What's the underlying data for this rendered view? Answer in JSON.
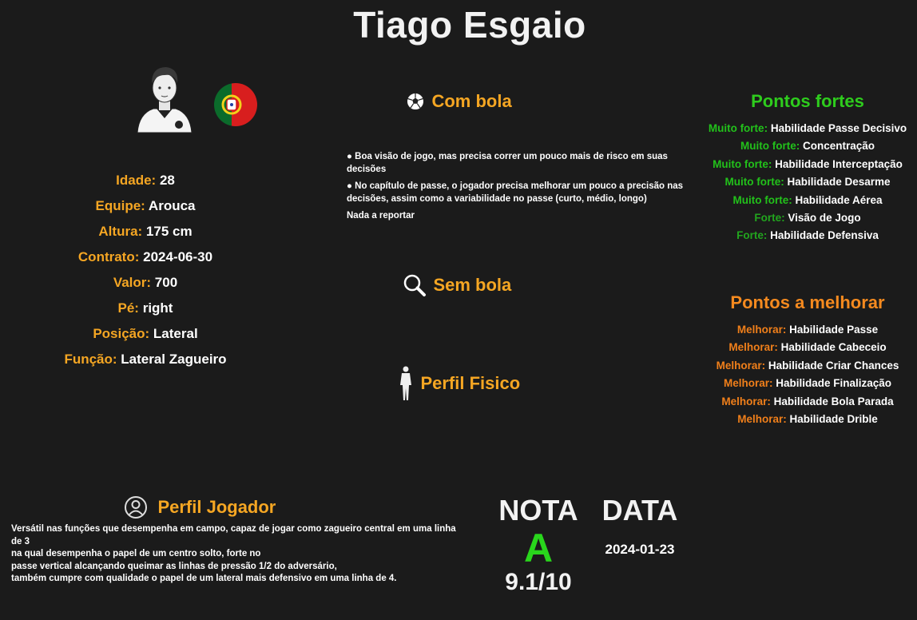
{
  "player": {
    "name": "Tiago Esgaio",
    "details": [
      {
        "label": "Idade:",
        "value": "28"
      },
      {
        "label": "Equipe:",
        "value": "Arouca"
      },
      {
        "label": "Altura:",
        "value": "175 cm"
      },
      {
        "label": "Contrato:",
        "value": "2024-06-30"
      },
      {
        "label": "Valor:",
        "value": "700"
      },
      {
        "label": "Pé:",
        "value": "right"
      },
      {
        "label": "Posição:",
        "value": "Lateral"
      },
      {
        "label": "Função:",
        "value": "Lateral Zagueiro"
      }
    ],
    "avatar_icon": "player-avatar-icon",
    "flag_icon": "portugal-flag-icon"
  },
  "com_bola": {
    "title": "Com bola",
    "icon": "soccer-ball-icon",
    "bullets": [
      "● Boa visão de jogo, mas precisa correr um pouco mais de risco em suas decisões",
      "● No capítulo de passe, o jogador precisa melhorar um pouco a precisão nas decisões, assim como a variabilidade no passe (curto, médio, longo)",
      "Nada a reportar"
    ]
  },
  "sem_bola": {
    "title": "Sem bola",
    "icon": "magnifier-icon"
  },
  "perfil_fisico": {
    "title": "Perfil Fisico",
    "icon": "body-silhouette-icon"
  },
  "pontos_fortes": {
    "title": "Pontos fortes",
    "items": [
      {
        "level": "Muito forte:",
        "skill": "Habilidade Passe Decisivo"
      },
      {
        "level": "Muito forte:",
        "skill": "Concentração"
      },
      {
        "level": "Muito forte:",
        "skill": "Habilidade Interceptação"
      },
      {
        "level": "Muito forte:",
        "skill": "Habilidade Desarme"
      },
      {
        "level": "Muito forte:",
        "skill": "Habilidade Aérea"
      },
      {
        "level": "Forte:",
        "skill": "Visão de Jogo"
      },
      {
        "level": "Forte:",
        "skill": "Habilidade Defensiva"
      }
    ]
  },
  "pontos_melhorar": {
    "title": "Pontos a melhorar",
    "items": [
      {
        "level": "Melhorar:",
        "skill": "Habilidade Passe"
      },
      {
        "level": "Melhorar:",
        "skill": "Habilidade Cabeceio"
      },
      {
        "level": "Melhorar:",
        "skill": "Habilidade Criar Chances"
      },
      {
        "level": "Melhorar:",
        "skill": "Habilidade Finalização"
      },
      {
        "level": "Melhorar:",
        "skill": "Habilidade Bola Parada"
      },
      {
        "level": "Melhorar:",
        "skill": "Habilidade Drible"
      }
    ]
  },
  "perfil_jogador": {
    "title": "Perfil Jogador",
    "icon": "user-circle-icon",
    "text": "Versátil nas funções que desempenha em campo, capaz de jogar como zagueiro central em uma linha de 3\nna qual desempenha o papel de um centro solto, forte no\npasse vertical alcançando queimar as linhas de pressão 1/2 do adversário,\ntambém cumpre com qualidade o papel de um lateral mais defensivo em uma linha de 4."
  },
  "nota": {
    "label": "NOTA",
    "grade": "A",
    "score": "9.1/10"
  },
  "data": {
    "label": "DATA",
    "value": "2024-01-23"
  },
  "colors": {
    "background": "#1b1b1b",
    "label_orange": "#f5a623",
    "strong_green": "#22c11b",
    "improve_orange": "#f07f1a",
    "grade_green": "#29d61c"
  }
}
